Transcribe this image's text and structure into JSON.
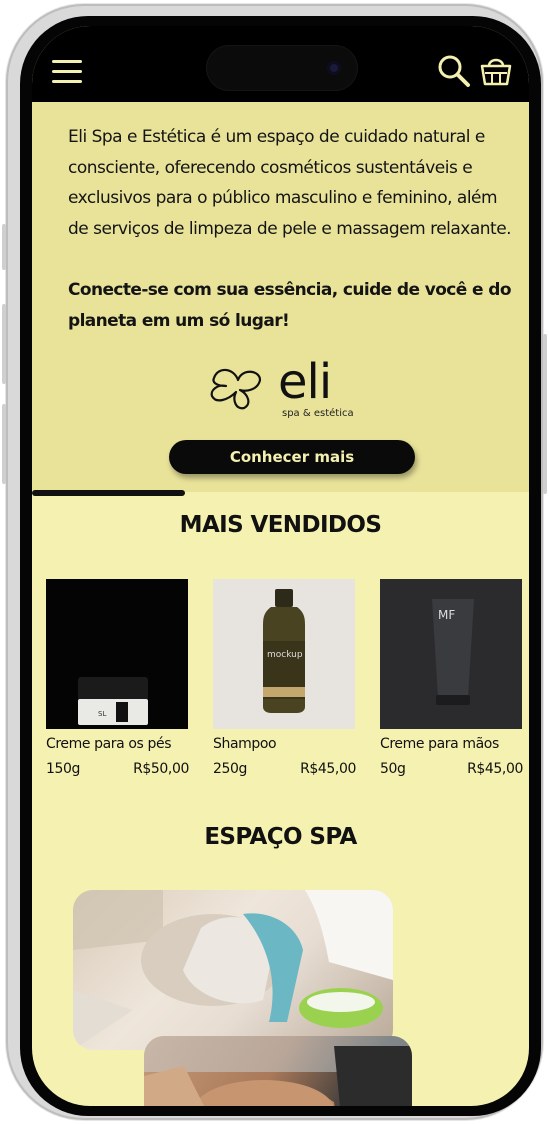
{
  "header": {
    "menu_icon": "hamburger-menu-icon",
    "search_icon": "search-icon",
    "cart_icon": "basket-icon"
  },
  "intro": {
    "text": "Eli Spa e Estética é um espaço de cuidado natural e consciente, oferecendo cosméticos sustentáveis e exclusivos para o público masculino e feminino, além de serviços de limpeza de pele e massagem relaxante.",
    "tagline": "Conecte-se com sua essência, cuide de você e do planeta em um só lugar!",
    "logo": {
      "word": "eli",
      "sub": "spa & estética"
    },
    "cta_label": "Conhecer mais"
  },
  "best_sellers": {
    "title": "MAIS VENDIDOS",
    "products": [
      {
        "name": "Creme para os pés",
        "size": "150g",
        "price": "R$50,00"
      },
      {
        "name": "Shampoo",
        "size": "250g",
        "price": "R$45,00"
      },
      {
        "name": "Creme para mãos",
        "size": "50g",
        "price": "R$45,00"
      }
    ]
  },
  "spa": {
    "title": "ESPAÇO SPA"
  },
  "colors": {
    "background": "#f5f2b1",
    "intro_bg": "#e9e39a",
    "header_bg": "#000000",
    "accent": "#f3f0b0"
  }
}
